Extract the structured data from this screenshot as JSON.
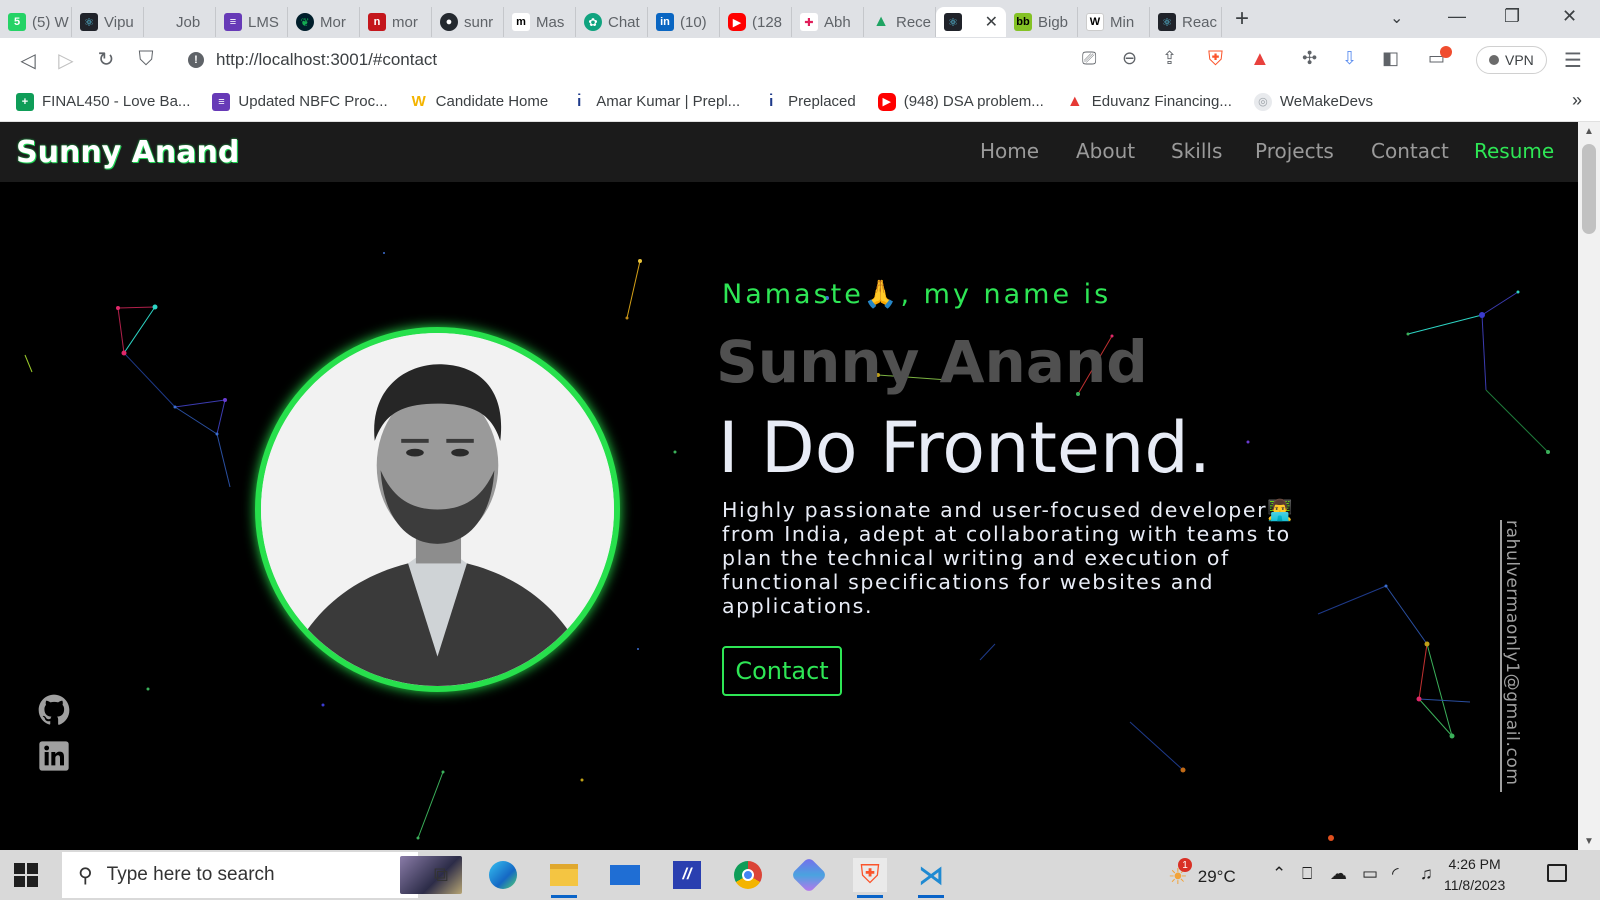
{
  "browser": {
    "tabs": [
      {
        "label": "(5) W",
        "icon": "whatsapp-icon",
        "color": "#25d366"
      },
      {
        "label": "Vipu",
        "icon": "react-icon",
        "color": "#20232a"
      },
      {
        "label": "Job",
        "icon": "blank-icon",
        "color": "#dfe1e5"
      },
      {
        "label": "LMS",
        "icon": "form-icon",
        "color": "#673ab7"
      },
      {
        "label": "Mor",
        "icon": "mongodb-icon",
        "color": "#13aa52"
      },
      {
        "label": "mor",
        "icon": "n-icon",
        "color": "#c4161c"
      },
      {
        "label": "sunr",
        "icon": "github-icon",
        "color": "#24292f"
      },
      {
        "label": "Mas",
        "icon": "m-icon",
        "color": "#ffffff"
      },
      {
        "label": "Chat",
        "icon": "chatgpt-icon",
        "color": "#10a37f"
      },
      {
        "label": "(10)",
        "icon": "linkedin-icon",
        "color": "#0a66c2"
      },
      {
        "label": "(128",
        "icon": "youtube-icon",
        "color": "#ff0000"
      },
      {
        "label": "Abh",
        "icon": "slack-icon",
        "color": "#e01e5a"
      },
      {
        "label": "Rece",
        "icon": "drive-icon",
        "color": "#1fa463"
      },
      {
        "label": "",
        "icon": "react-icon",
        "color": "#20232a",
        "active": true
      },
      {
        "label": "Bigb",
        "icon": "bigbasket-icon",
        "color": "#84c225"
      },
      {
        "label": "Min",
        "icon": "w-icon",
        "color": "#ffffff"
      },
      {
        "label": "Reac",
        "icon": "react-icon",
        "color": "#20232a"
      }
    ],
    "url": "http://localhost:3001/#contact",
    "vpn_label": "VPN",
    "bookmarks": [
      {
        "label": "FINAL450 - Love Ba...",
        "icon": "sheets-icon",
        "color": "#0f9d58"
      },
      {
        "label": "Updated NBFC Proc...",
        "icon": "form-icon",
        "color": "#673ab7"
      },
      {
        "label": "Candidate Home",
        "icon": "w-logo-icon",
        "color": "#f4b400"
      },
      {
        "label": "Amar Kumar | Prepl...",
        "icon": "preplaced-icon",
        "color": "#1e3a8a"
      },
      {
        "label": "Preplaced",
        "icon": "preplaced-icon",
        "color": "#1e3a8a"
      },
      {
        "label": "(948) DSA problem...",
        "icon": "youtube-icon",
        "color": "#ff0000"
      },
      {
        "label": "Eduvanz Financing...",
        "icon": "eduvanz-icon",
        "color": "#e53935"
      },
      {
        "label": "WeMakeDevs",
        "icon": "wemakedevs-icon",
        "color": "#9aa0a6"
      }
    ]
  },
  "site": {
    "brand": "Sunny Anand",
    "nav": [
      {
        "label": "Home"
      },
      {
        "label": "About"
      },
      {
        "label": "Skills"
      },
      {
        "label": "Projects"
      },
      {
        "label": "Contact"
      },
      {
        "label": "Resume"
      }
    ],
    "hero": {
      "greeting": "Namaste🙏, my name is",
      "name": "Sunny Anand",
      "tagline": "I Do Frontend.",
      "bio": "Highly passionate and user-focused developer👨‍💻 from India, adept at collaborating with teams to plan the technical writing and execution of functional specifications for websites and applications.",
      "cta": "Contact"
    },
    "email": "rahulvermaonly1@gmail.com",
    "accent_color": "#2ee655"
  },
  "taskbar": {
    "search_placeholder": "Type here to search",
    "weather": "29°C",
    "weather_badge": "1",
    "time": "4:26 PM",
    "date": "11/8/2023"
  }
}
